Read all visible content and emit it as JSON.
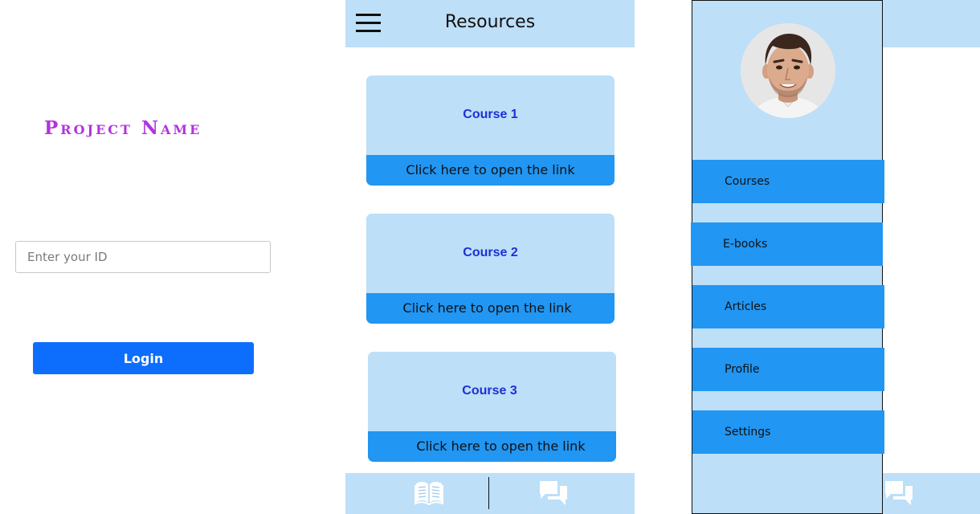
{
  "login": {
    "project_name": "Project Name",
    "id_placeholder": "Enter your ID",
    "login_label": "Login"
  },
  "resources": {
    "title": "Resources",
    "cards": [
      {
        "title": "Course 1",
        "link_label": "Click here to open the link"
      },
      {
        "title": "Course 2",
        "link_label": "Click here to open the link"
      },
      {
        "title": "Course 3",
        "link_label": "Click here to open the link"
      }
    ],
    "footer_icons": [
      "book-icon",
      "chat-icon"
    ]
  },
  "drawer": {
    "menu": [
      "Courses",
      "E-books",
      "Articles",
      "Profile",
      "Settings"
    ]
  },
  "colors": {
    "panel": "#bddff8",
    "accent": "#2196f3",
    "login_button": "#0d6efd",
    "project_name": "#b233e0",
    "card_title": "#1e2fd6"
  }
}
